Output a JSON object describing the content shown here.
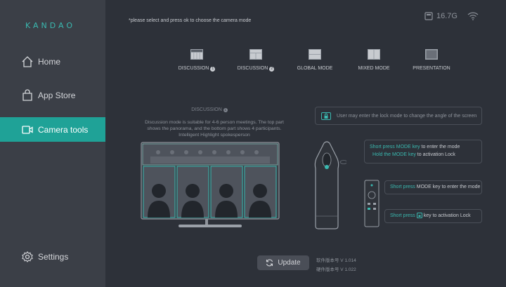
{
  "brand": {
    "logo_text": "KANDAO",
    "accent": "#1fa297"
  },
  "sidebar": {
    "items": [
      {
        "label": "Home",
        "icon": "home-icon"
      },
      {
        "label": "App Store",
        "icon": "store-icon"
      },
      {
        "label": "Camera tools",
        "icon": "camera-icon",
        "active": true
      },
      {
        "label": "Settings",
        "icon": "gear-icon"
      }
    ]
  },
  "header": {
    "hint": "*please select and press ok to choose the camera mode",
    "storage": "16.7G",
    "storage_icon": "sd-card-icon",
    "wifi_icon": "wifi-icon"
  },
  "modes": [
    {
      "label": "DISCUSSION",
      "badge": "1",
      "icon": "discussion-1-icon"
    },
    {
      "label": "DISCUSSION",
      "badge": "2",
      "icon": "discussion-2-icon"
    },
    {
      "label": "GLOBAL MODE",
      "icon": "global-mode-icon"
    },
    {
      "label": "MIXED MODE",
      "icon": "mixed-mode-icon"
    },
    {
      "label": "PRESENTATION",
      "icon": "presentation-icon"
    }
  ],
  "detail": {
    "title": "DISCUSSION",
    "title_badge": "1",
    "description_line1": "Discussion mode is suitable for 4-6 person meetings. The top part",
    "description_line2": "shows the panorama, and the bottom part shows 4 participants.",
    "description_line3": "Intelligent Highlight spokesperson"
  },
  "lock": {
    "text": "User may enter the lock mode to change the angle of the screen",
    "icon": "lock-icon"
  },
  "camera_keys": {
    "short_press_a": "Short press MODE key",
    "short_press_b": " to enter the mode",
    "hold_a": "Hold the MODE key",
    "hold_b": " to activation Lock"
  },
  "remote_keys": {
    "short_a": "Short press",
    "short_b": " MODE key to enter the mode",
    "lock_a": "Short press",
    "lock_b": " key to activation Lock"
  },
  "footer": {
    "update_label": "Update",
    "software_version": "软件版本号  V 1.014",
    "hardware_version": "硬件版本号  V 1.022"
  }
}
